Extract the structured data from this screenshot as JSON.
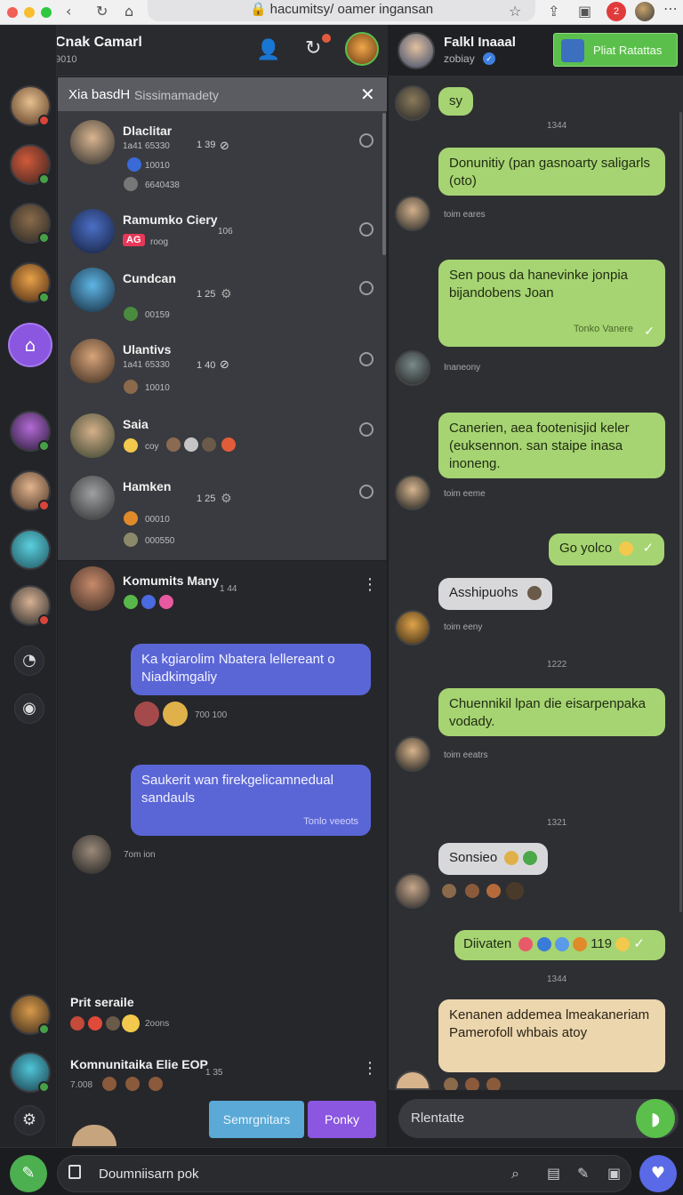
{
  "browser": {
    "url": "hacumitsy/ oamer ingansan",
    "notif_count": "2"
  },
  "left_header": {
    "name": "Cnak Camarl",
    "status": "9010"
  },
  "popup": {
    "search_text": "Xia basdH",
    "search_placeholder": "Sissimamadety",
    "rows": [
      {
        "name": "Dlaclitar",
        "sub1": "1a41 65330",
        "sub2": "10010",
        "sub3": "6640438",
        "time": "1 39"
      },
      {
        "name": "Ramumko Ciery",
        "sub1": "106",
        "sub2": "",
        "sub3": "",
        "time": "",
        "tag": "AG",
        "tag_text": "roog"
      },
      {
        "name": "Cundcan",
        "sub1": "",
        "sub2": "00159",
        "sub3": "",
        "time": "1 25"
      },
      {
        "name": "Ulantivs",
        "sub1": "1a41 65330",
        "sub2": "10010",
        "sub3": "",
        "time": "1 40"
      },
      {
        "name": "Saia",
        "sub1": "",
        "sub2": "coy",
        "sub3": "",
        "time": ""
      },
      {
        "name": "Hamken",
        "sub1": "",
        "sub2": "00010",
        "sub3": "000550",
        "time": "1 25"
      }
    ]
  },
  "left_chat": {
    "header_name": "Komumits Many",
    "header_time": "1 44",
    "bubble1": "Ka kgiarolim Nbatera lellereant o Niadkimgaliy",
    "bubble1_time": "700 100",
    "bubble2": "Saukerit wan firekgelicamnedual sandauls",
    "bubble2_footer": "Tonlo veeots",
    "sender_time": "7om ion",
    "conv1_name": "Prit seraile",
    "conv1_time": "2oons",
    "conv2_name": "Komnunitaika Elie EOP",
    "conv2_time": "1 35",
    "conv2_sub": "7.008",
    "btn_secondary": "Semrgnitars",
    "btn_primary": "Ponky"
  },
  "right_header": {
    "name": "Falkl Inaaal",
    "status": "zobiay",
    "action": "Pliat Ratattas"
  },
  "right_chat": {
    "messages": [
      {
        "text": "sy"
      },
      {
        "text": "1344"
      },
      {
        "text": "Donunitiy (pan gasnoarty saligarls (oto)"
      },
      {
        "text": "toim eares"
      },
      {
        "text": "Sen pous da hanevinke jonpia bijandobens Joan"
      },
      {
        "text": "Tonko Vanere"
      },
      {
        "text": "Inaneony"
      },
      {
        "text": "Canerien, aea footenisjid keler (euksennon. san staipe inasa inoneng."
      },
      {
        "text": "toim eeme"
      },
      {
        "text": "Go yolco"
      },
      {
        "text": "Asshipuohs"
      },
      {
        "text": "toim eeny"
      },
      {
        "text": "1222"
      },
      {
        "text": "Chuennikil lpan die eisarpenpaka vodady."
      },
      {
        "text": "toim eeatrs"
      },
      {
        "text": "1321"
      },
      {
        "text": "Sonsieo"
      },
      {
        "text": "Diivaten"
      },
      {
        "text": "119"
      },
      {
        "text": "1344"
      },
      {
        "text": "Kenanen addemea lmeakaneriam Pamerofoll whbais atoy"
      }
    ]
  },
  "compose": {
    "right_placeholder": "Rlentatte",
    "bottom_placeholder": "Doumniisarn pok"
  },
  "colors": {
    "green_bubble": "#a6d472",
    "blue_bubble": "#5b66d6",
    "accent_purple": "#8b56e0",
    "accent_green": "#4caf50"
  }
}
